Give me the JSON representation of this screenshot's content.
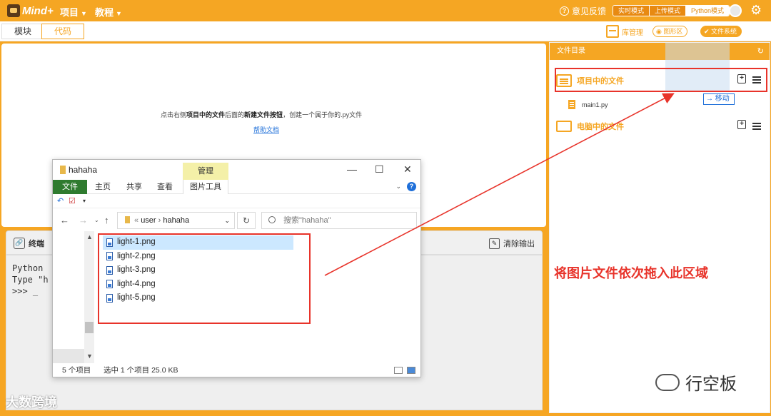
{
  "app": {
    "logo_text": "Mind+"
  },
  "menu": {
    "project": "项目",
    "tutorial": "教程"
  },
  "header": {
    "feedback": "意见反馈",
    "modes": [
      "实时模式",
      "上传模式",
      "Python模式"
    ],
    "active_mode": "Python模式"
  },
  "tabs": {
    "blocks": "模块",
    "code": "代码"
  },
  "toolbar": {
    "library": "库管理",
    "drawing": "图形区",
    "filesystem": "文件系统"
  },
  "editor": {
    "hint_pre": "点击右侧",
    "hint_b1": "项目中的文件",
    "hint_mid": "后面的",
    "hint_b2": "新建文件按钮",
    "hint_post": "，创建一个属于你的.py文件",
    "help_link": "帮助文档"
  },
  "terminal": {
    "title": "终端",
    "clear": "清除输出",
    "lines": [
      "Python",
      "Type \"h",
      ">>> _"
    ]
  },
  "file_panel": {
    "title": "文件目录",
    "project_files": "项目中的文件",
    "computer_files": "电脑中的文件",
    "file": "main1.py",
    "move_tip": "→ 移动"
  },
  "explorer": {
    "window_title": "hahaha",
    "manage_tab": "管理",
    "ribbon_tabs": [
      "文件",
      "主页",
      "共享",
      "查看",
      "图片工具"
    ],
    "path": [
      "user",
      "hahaha"
    ],
    "search_placeholder": "搜索\"hahaha\"",
    "files": [
      "light-1.png",
      "light-2.png",
      "light-3.png",
      "light-4.png",
      "light-5.png"
    ],
    "selected_file": "light-1.png",
    "status_count": "5 个项目",
    "status_selection": "选中 1 个项目  25.0 KB"
  },
  "annotation": "将图片文件依次拖入此区域",
  "watermarks": {
    "left": "大数跨境",
    "right": "行空板"
  },
  "colors": {
    "brand": "#f5a623",
    "annotation_red": "#e8332a",
    "selection": "#cce8ff"
  }
}
